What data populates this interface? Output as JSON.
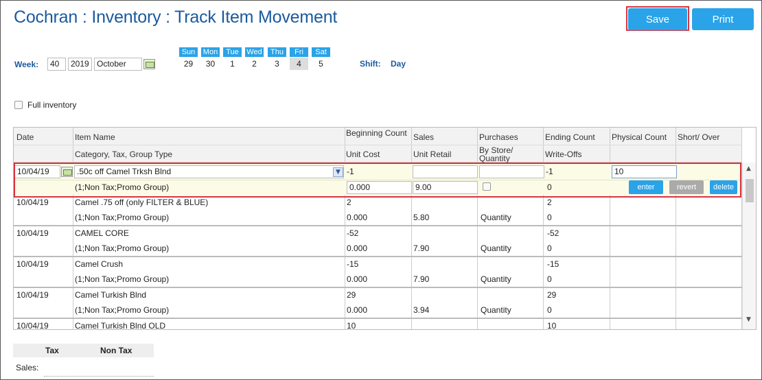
{
  "title": "Cochran : Inventory : Track Item Movement",
  "buttons": {
    "save": "Save",
    "print": "Print"
  },
  "week": {
    "label": "Week:",
    "number": "40",
    "year": "2019",
    "month": "October",
    "days": [
      {
        "name": "Sun",
        "date": "29"
      },
      {
        "name": "Mon",
        "date": "30"
      },
      {
        "name": "Tue",
        "date": "1"
      },
      {
        "name": "Wed",
        "date": "2"
      },
      {
        "name": "Thu",
        "date": "3"
      },
      {
        "name": "Fri",
        "date": "4"
      },
      {
        "name": "Sat",
        "date": "5"
      }
    ],
    "selected_day": "Fri"
  },
  "shift": {
    "label": "Shift:",
    "value": "Day"
  },
  "full_inventory": {
    "label": "Full inventory",
    "checked": false
  },
  "table": {
    "headers_row1": [
      "Date",
      "Item Name",
      "Beginning Count",
      "Sales",
      "Purchases",
      "Ending Count",
      "Physical Count",
      "Short/ Over"
    ],
    "headers_row2": [
      "",
      "Category, Tax, Group Type",
      "Unit Cost",
      "Unit Retail",
      "By Store/ Quantity",
      "Write-Offs",
      "",
      ""
    ],
    "edit_row": {
      "date": "10/04/19",
      "item": ".50c off Camel Trksh Blnd",
      "category": "(1;Non Tax;Promo Group)",
      "beginning": "-1",
      "sales": "",
      "purchases": "",
      "ending": "-1",
      "physical": "10",
      "unit_cost": "0.000",
      "unit_retail": "9.00",
      "writeoffs": "0",
      "actions": {
        "enter": "enter",
        "revert": "revert",
        "delete": "delete"
      }
    },
    "rows": [
      {
        "date": "10/04/19",
        "item": "Camel .75 off (only FILTER & BLUE)",
        "category": "(1;Non Tax;Promo Group)",
        "beginning": "2",
        "unit_cost": "0.000",
        "unit_retail": "5.80",
        "by": "Quantity",
        "ending": "2",
        "writeoffs": "0"
      },
      {
        "date": "10/04/19",
        "item": "CAMEL CORE",
        "category": "(1;Non Tax;Promo Group)",
        "beginning": "-52",
        "unit_cost": "0.000",
        "unit_retail": "7.90",
        "by": "Quantity",
        "ending": "-52",
        "writeoffs": "0"
      },
      {
        "date": "10/04/19",
        "item": "Camel Crush",
        "category": "(1;Non Tax;Promo Group)",
        "beginning": "-15",
        "unit_cost": "0.000",
        "unit_retail": "7.90",
        "by": "Quantity",
        "ending": "-15",
        "writeoffs": "0"
      },
      {
        "date": "10/04/19",
        "item": "Camel Turkish Blnd",
        "category": "(1;Non Tax;Promo Group)",
        "beginning": "29",
        "unit_cost": "0.000",
        "unit_retail": "3.94",
        "by": "Quantity",
        "ending": "29",
        "writeoffs": "0"
      },
      {
        "date": "10/04/19",
        "item": "Camel Turkish Blnd OLD",
        "beginning": "10",
        "ending": "10"
      }
    ]
  },
  "summary": {
    "tax": "Tax",
    "non_tax": "Non Tax",
    "sales_label": "Sales:"
  },
  "colors": {
    "accent": "#2aa3e8",
    "title": "#1a5a9e",
    "highlight_border": "#d9333f",
    "edit_row_bg": "#fbfbe6"
  }
}
